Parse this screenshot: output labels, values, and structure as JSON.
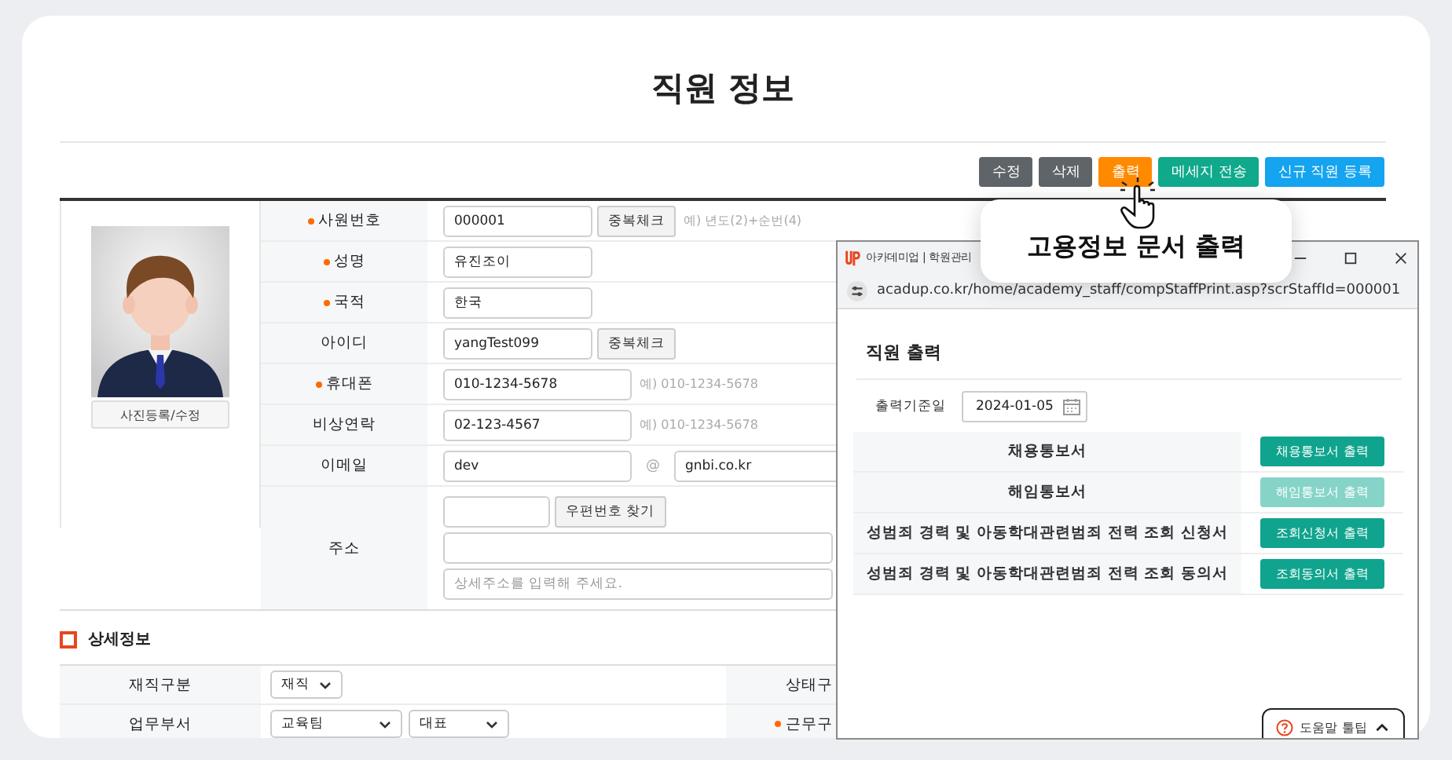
{
  "page": {
    "title": "직원 정보"
  },
  "toolbar": [
    {
      "label": "수정",
      "kind": "neutral"
    },
    {
      "label": "삭제",
      "kind": "neutral"
    },
    {
      "label": "출력",
      "kind": "print"
    },
    {
      "label": "메세지 전송",
      "kind": "message"
    },
    {
      "label": "신규 직원 등록",
      "kind": "create"
    }
  ],
  "tooltip": {
    "text": "고용정보 문서 출력"
  },
  "profile": {
    "photo_button": "사진등록/수정"
  },
  "fields": [
    {
      "label": "사원번호",
      "required": true,
      "value": "000001",
      "button": "중복체크",
      "hint": "예) 년도(2)+순번(4)"
    },
    {
      "label": "성명",
      "required": true,
      "value": "유진조이"
    },
    {
      "label": "국적",
      "required": true,
      "value": "한국"
    },
    {
      "label": "아이디",
      "required": false,
      "value": "yangTest099",
      "button": "중복체크"
    },
    {
      "label": "휴대폰",
      "required": true,
      "value": "010-1234-5678",
      "hint": "예) 010-1234-5678"
    },
    {
      "label": "비상연락",
      "required": false,
      "value": "02-123-4567",
      "hint": "예) 010-1234-5678"
    }
  ],
  "email": {
    "label": "이메일",
    "user": "dev",
    "at": "@",
    "domain": "gnbi.co.kr"
  },
  "address": {
    "label": "주소",
    "zip_button": "우편번호 찾기",
    "detail_placeholder": "상세주소를 입력해 주세요."
  },
  "detail": {
    "title": "상세정보",
    "rows": [
      {
        "label": "재직구분",
        "selects": [
          "재직"
        ],
        "right_label": "상태구",
        "right_required": false
      },
      {
        "label": "업무부서",
        "selects": [
          "교육팀",
          "대표"
        ],
        "right_label": "근무구",
        "right_required": true
      }
    ]
  },
  "popup": {
    "title": "아카데미업 | 학원관리",
    "url": "acadup.co.kr/home/academy_staff/compStaffPrint.asp?scrStaffId=000001",
    "heading": "직원 출력",
    "date_label": "출력기준일",
    "date_value": "2024-01-05",
    "documents": [
      {
        "name": "채용통보서",
        "button": "채용통보서 출력",
        "disabled": false
      },
      {
        "name": "해임통보서",
        "button": "해임통보서 출력",
        "disabled": true
      },
      {
        "name": "성범죄 경력 및 아동학대관련범죄 전력 조회 신청서",
        "button": "조회신청서 출력",
        "disabled": false
      },
      {
        "name": "성범죄 경력 및 아동학대관련범죄 전력 조회 동의서",
        "button": "조회동의서 출력",
        "disabled": false
      }
    ],
    "help_button": "도움말 툴팁"
  }
}
